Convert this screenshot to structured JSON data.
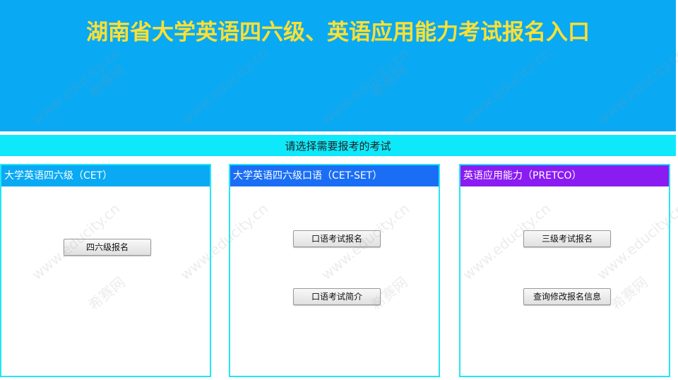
{
  "header": {
    "title": "湖南省大学英语四六级、英语应用能力考试报名入口"
  },
  "select_bar": {
    "text": "请选择需要报考的考试"
  },
  "panels": [
    {
      "title": "大学英语四六级（CET）",
      "color": "#0aa9f3",
      "buttons": [
        "四六级报名"
      ]
    },
    {
      "title": "大学英语四六级口语（CET-SET）",
      "color": "#1a6ef5",
      "buttons": [
        "口语考试报名",
        "口语考试简介"
      ]
    },
    {
      "title": "英语应用能力（PRETCO）",
      "color": "#8a1cf2",
      "buttons": [
        "三级考试报名",
        "查询修改报名信息"
      ]
    }
  ],
  "watermark": {
    "text_site": "www.educity.cn",
    "text_brand": "希赛网"
  }
}
